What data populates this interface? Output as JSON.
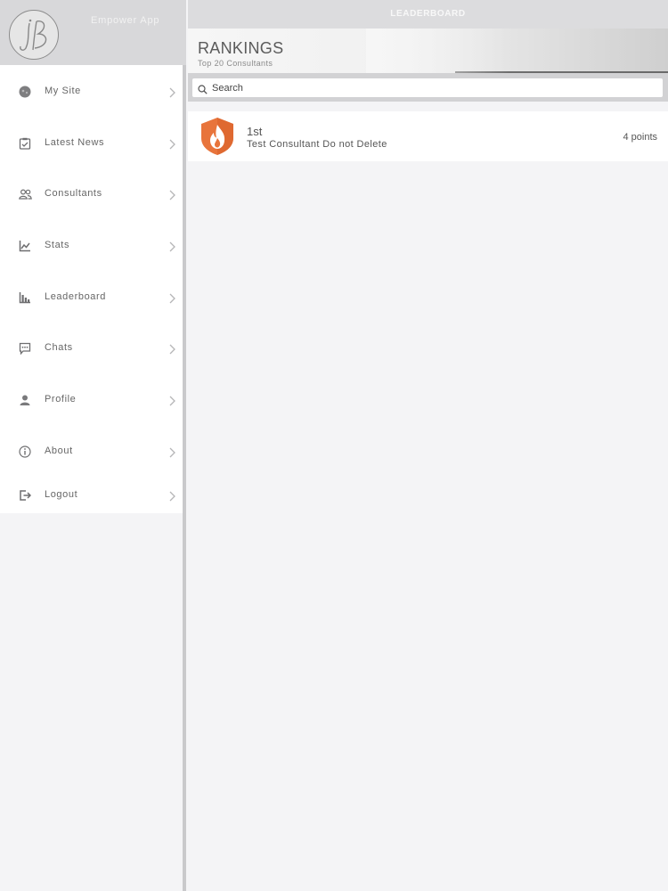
{
  "sidebar": {
    "app_name": "Empower App",
    "items": [
      {
        "label": "My Site",
        "icon": "globe-icon"
      },
      {
        "label": "Latest News",
        "icon": "clipboard-icon"
      },
      {
        "label": "Consultants",
        "icon": "people-icon"
      },
      {
        "label": "Stats",
        "icon": "line-chart-icon"
      },
      {
        "label": "Leaderboard",
        "icon": "bar-chart-icon"
      },
      {
        "label": "Chats",
        "icon": "chat-icon"
      },
      {
        "label": "Profile",
        "icon": "user-icon"
      },
      {
        "label": "About",
        "icon": "info-icon"
      },
      {
        "label": "Logout",
        "icon": "logout-icon"
      }
    ]
  },
  "navbar": {
    "title": "LEADERBOARD"
  },
  "banner": {
    "title": "RANKINGS",
    "subtitle": "Top 20 Consultants"
  },
  "search": {
    "placeholder": "Search",
    "value": ""
  },
  "rankings": [
    {
      "position": "1st",
      "name": "Test Consultant Do not Delete",
      "points": "4 points",
      "badge_color": "#e8743b",
      "badge_icon": "flame-icon"
    }
  ]
}
